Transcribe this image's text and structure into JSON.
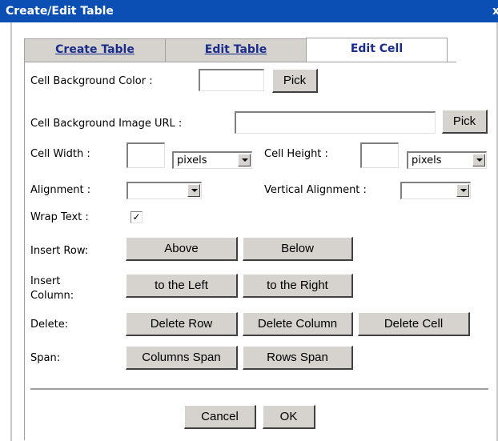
{
  "window": {
    "title": "Create/Edit Table",
    "close_glyph": "x"
  },
  "tabs": [
    {
      "label": "Create Table"
    },
    {
      "label": "Edit Table"
    },
    {
      "label": "Edit Cell"
    }
  ],
  "form": {
    "cell_bg_color_label": "Cell Background Color :",
    "cell_bg_color_value": "",
    "pick_label": "Pick",
    "cell_bg_image_label": "Cell Background Image URL :",
    "cell_bg_image_value": "",
    "cell_width_label": "Cell Width :",
    "cell_width_value": "",
    "cell_width_unit": "pixels",
    "cell_height_label": "Cell Height :",
    "cell_height_value": "",
    "cell_height_unit": "pixels",
    "alignment_label": "Alignment :",
    "alignment_value": "",
    "valign_label": "Vertical Alignment :",
    "valign_value": "",
    "wrap_text_label": "Wrap Text :",
    "wrap_text_checked": true,
    "wrap_text_mark": "✓"
  },
  "actions": {
    "insert_row_label": "Insert Row:",
    "above": "Above",
    "below": "Below",
    "insert_column_label": "Insert Column:",
    "insert_column_line1": "Insert",
    "insert_column_line2": "Column:",
    "to_left": "to the Left",
    "to_right": "to the Right",
    "delete_label": "Delete:",
    "delete_row": "Delete Row",
    "delete_column": "Delete Column",
    "delete_cell": "Delete Cell",
    "span_label": "Span:",
    "columns_span": "Columns Span",
    "rows_span": "Rows Span"
  },
  "footer": {
    "cancel": "Cancel",
    "ok": "OK"
  }
}
